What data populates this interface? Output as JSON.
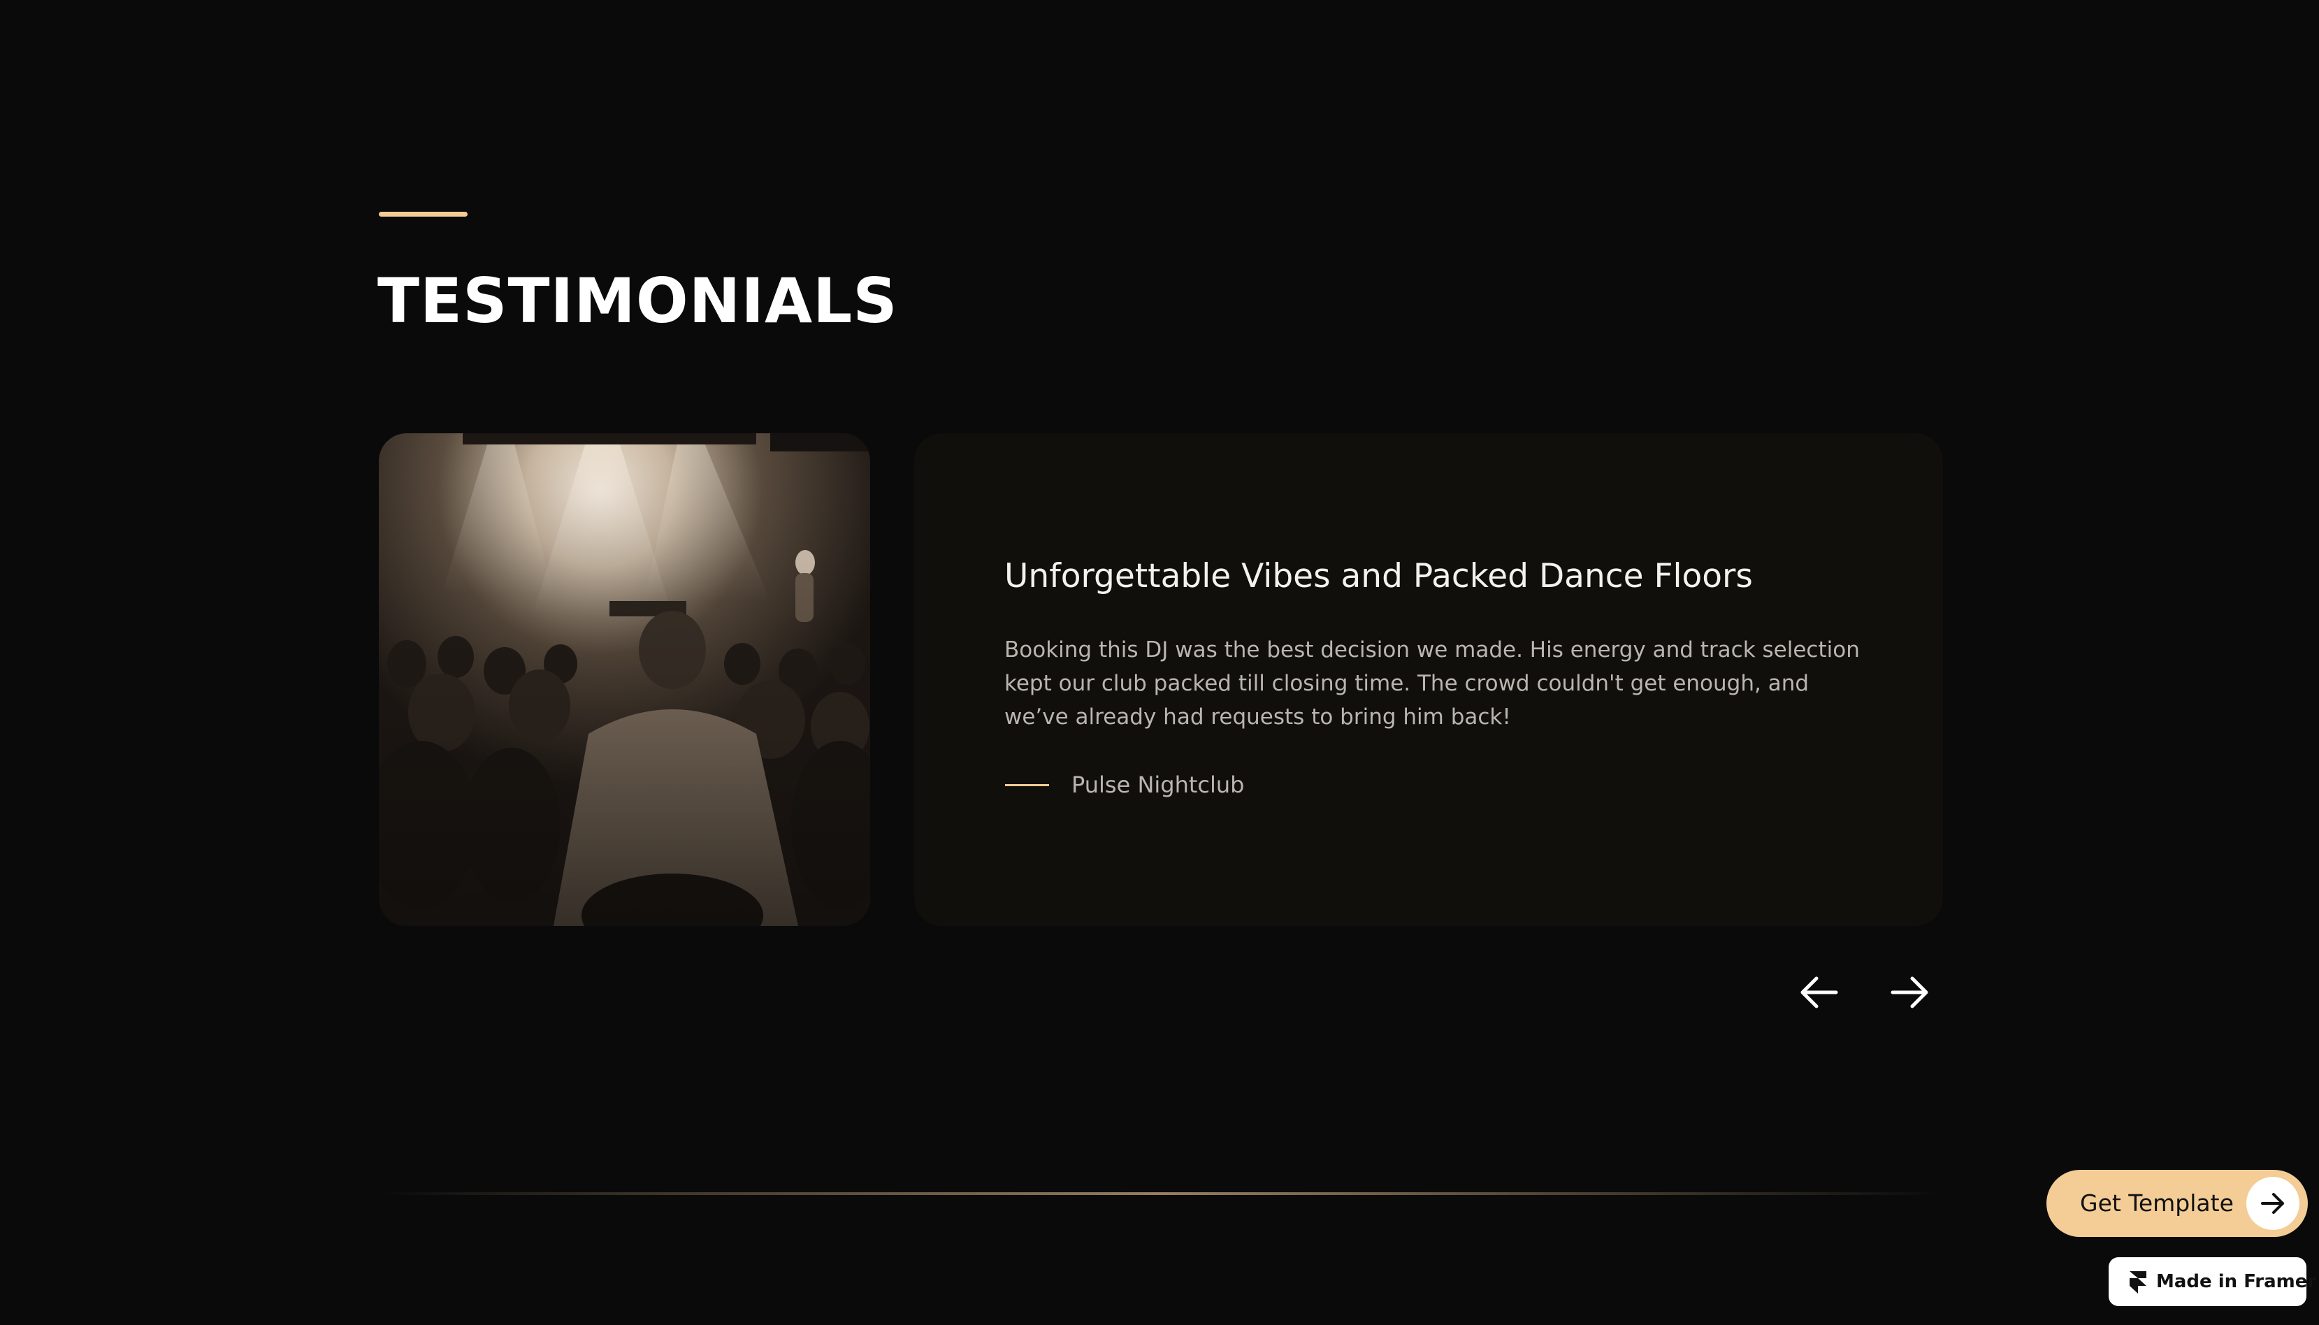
{
  "section": {
    "title": "TESTIMONIALS"
  },
  "testimonial": {
    "image_alt": "Crowd at a nightclub concert facing the stage under smoky lights",
    "title": "Unforgettable Vibes and Packed Dance Floors",
    "body": "Booking this DJ was the best decision we made. His energy and track selection kept our club packed till closing time. The crowd couldn't get enough, and we’ve already had requests to bring him back!",
    "author": "Pulse Nightclub"
  },
  "navigation": {
    "prev_icon": "arrow-left-icon",
    "next_icon": "arrow-right-icon"
  },
  "cta": {
    "get_template_label": "Get Template",
    "get_template_icon": "arrow-right-icon",
    "made_in_framer_label": "Made in Framer",
    "made_in_framer_icon": "framer-logo-icon"
  },
  "colors": {
    "background": "#0a0a0b",
    "card": "#110f0b",
    "accent": "#f3cd95",
    "text_primary": "#ffffff",
    "text_secondary": "#b9b6b0"
  }
}
